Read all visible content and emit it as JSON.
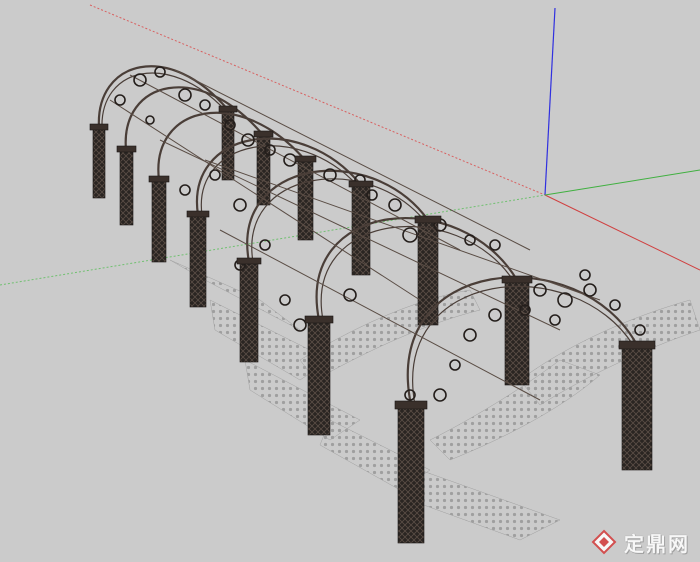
{
  "viewport": {
    "background": "#cbcbcb",
    "axis_colors": {
      "x": "#d04040",
      "y": "#40b040",
      "z": "#3030e0"
    }
  },
  "model": {
    "type": "iron-arch-pergola",
    "arch_count": 7,
    "post_color": "#2a2522",
    "arch_color": "#4a3e38",
    "shadow_color": "#a8a8a8"
  },
  "watermark": {
    "text": "定鼎网",
    "logo_icon": "diamond-logo-icon",
    "color": "#d43a3a"
  }
}
